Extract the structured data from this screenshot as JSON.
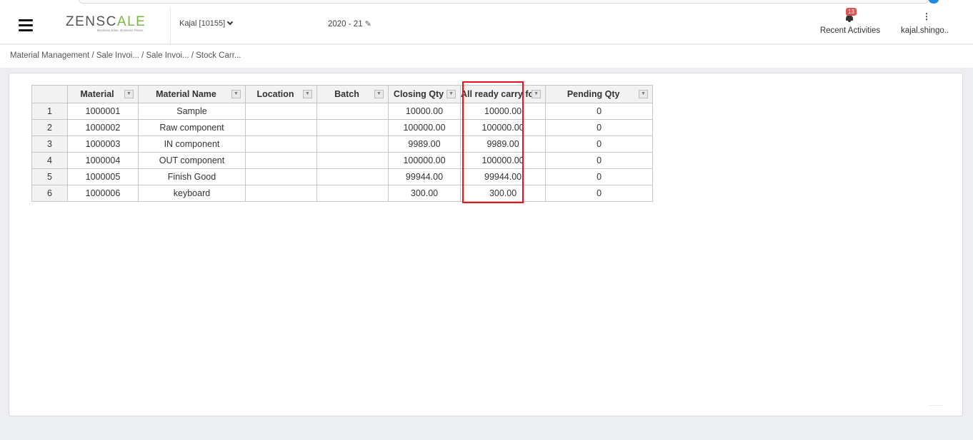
{
  "header": {
    "logo_text_main": "ZENSC",
    "logo_text_accent": "A",
    "logo_text_end": "LE",
    "logo_tagline": "Business Ease, Business Peace",
    "company": "Kajal [10155]",
    "fiscal_year": "2020 - 21",
    "recent_activities_label": "Recent Activities",
    "notification_count": "13",
    "user_name": "kajal.shingo.."
  },
  "breadcrumb": {
    "items": [
      "Material Management",
      "/ Sale Invoi...",
      "/ Sale Invoi...",
      "/ Stock Carr..."
    ]
  },
  "table": {
    "columns": [
      "Material",
      "Material Name",
      "Location",
      "Batch",
      "Closing Qty",
      "All ready carry fo",
      "Pending Qty"
    ],
    "rows": [
      {
        "n": "1",
        "material": "1000001",
        "name": "Sample",
        "location": "",
        "batch": "",
        "closing": "10000.00",
        "carried": "10000.00",
        "pending": "0"
      },
      {
        "n": "2",
        "material": "1000002",
        "name": "Raw component",
        "location": "",
        "batch": "",
        "closing": "100000.00",
        "carried": "100000.00",
        "pending": "0"
      },
      {
        "n": "3",
        "material": "1000003",
        "name": "IN component",
        "location": "",
        "batch": "",
        "closing": "9989.00",
        "carried": "9989.00",
        "pending": "0"
      },
      {
        "n": "4",
        "material": "1000004",
        "name": "OUT component",
        "location": "",
        "batch": "",
        "closing": "100000.00",
        "carried": "100000.00",
        "pending": "0"
      },
      {
        "n": "5",
        "material": "1000005",
        "name": "Finish Good",
        "location": "",
        "batch": "",
        "closing": "99944.00",
        "carried": "99944.00",
        "pending": "0"
      },
      {
        "n": "6",
        "material": "1000006",
        "name": "keyboard",
        "location": "",
        "batch": "",
        "closing": "300.00",
        "carried": "300.00",
        "pending": "0"
      }
    ]
  },
  "colors": {
    "highlight_box": "#e8131c",
    "logo_accent": "#7ab648",
    "badge": "#d9534f"
  }
}
